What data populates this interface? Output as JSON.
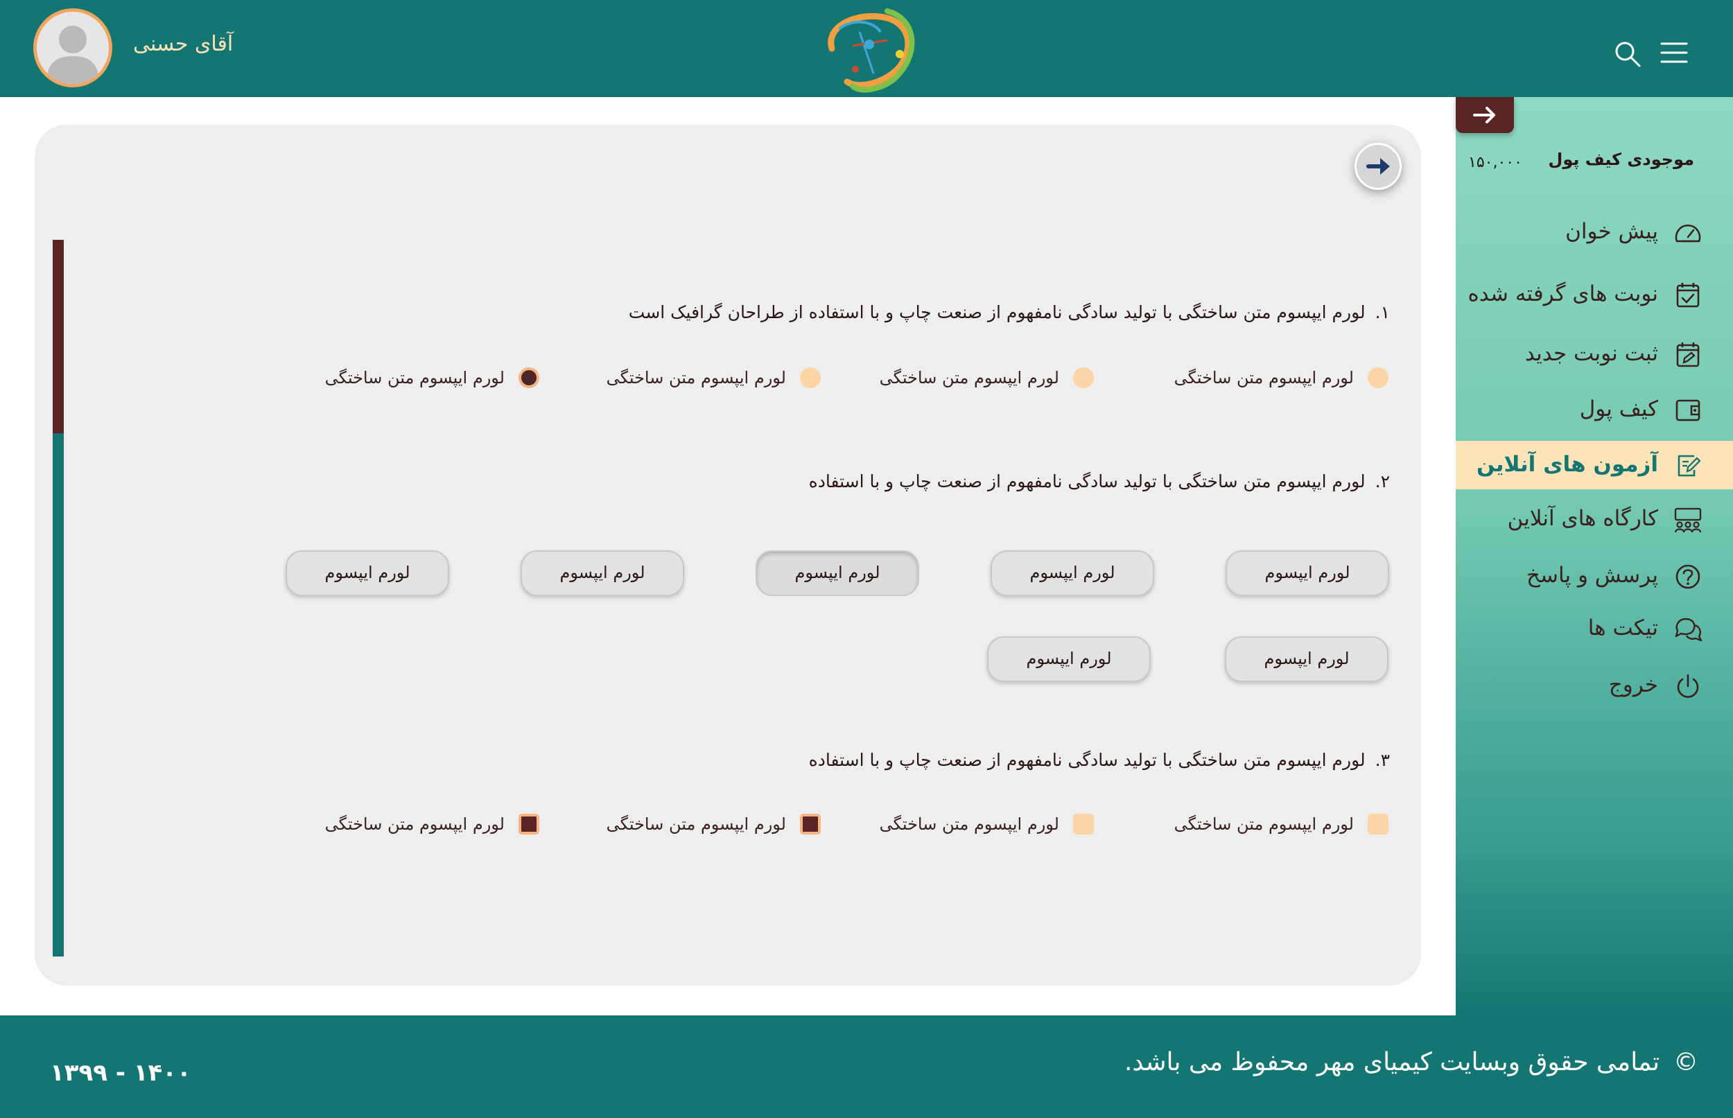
{
  "header": {
    "username": "آقای حسنی"
  },
  "sidebar": {
    "wallet_label": "موجودی کیف پول",
    "wallet_amount": "۱۵۰,۰۰۰",
    "items": [
      {
        "label": "پیش خوان",
        "icon": "speedometer-icon"
      },
      {
        "label": "نوبت های گرفته شده",
        "icon": "calendar-check-icon"
      },
      {
        "label": "ثبت نوبت جدید",
        "icon": "calendar-edit-icon"
      },
      {
        "label": "کیف پول",
        "icon": "wallet-icon"
      },
      {
        "label": "آزمون های آنلاین",
        "icon": "exam-edit-icon",
        "active": true
      },
      {
        "label": "کارگاه های آنلاین",
        "icon": "workshop-icon"
      },
      {
        "label": "پرسش و پاسخ",
        "icon": "question-circle-icon"
      },
      {
        "label": "تیکت ها",
        "icon": "chat-bubbles-icon"
      },
      {
        "label": "خروج",
        "icon": "power-icon"
      }
    ]
  },
  "exam": {
    "progress": 0.27,
    "questions": [
      {
        "number": "۱.",
        "text": "لورم ایپسوم متن ساختگی با تولید سادگی نامفهوم از صنعت چاپ و با استفاده از طراحان گرافیک است",
        "type": "radio",
        "options": [
          "لورم ایپسوم متن ساختگی",
          "لورم ایپسوم متن ساختگی",
          "لورم ایپسوم متن ساختگی",
          "لورم ایپسوم متن ساختگی"
        ],
        "selected": [
          3
        ]
      },
      {
        "number": "۲.",
        "text": "لورم ایپسوم متن ساختگی با تولید سادگی نامفهوم از صنعت چاپ و با استفاده",
        "type": "buttons",
        "options": [
          "لورم ایپسوم",
          "لورم ایپسوم",
          "لورم ایپسوم",
          "لورم ایپسوم",
          "لورم ایپسوم",
          "لورم ایپسوم",
          "لورم ایپسوم"
        ],
        "selected": [
          2
        ]
      },
      {
        "number": "۳.",
        "text": "لورم ایپسوم متن ساختگی با تولید سادگی نامفهوم از صنعت چاپ و با استفاده",
        "type": "checkbox",
        "options": [
          "لورم ایپسوم متن ساختگی",
          "لورم ایپسوم متن ساختگی",
          "لورم ایپسوم متن ساختگی",
          "لورم ایپسوم متن ساختگی"
        ],
        "selected": [
          2,
          3
        ]
      }
    ]
  },
  "footer": {
    "copyright": "تمامی حقوق وبسایت کیمیای مهر محفوظ می باشد.",
    "years": "۱۳۹۹ - ۱۴۰۰"
  },
  "colors": {
    "primary": "#147672",
    "accent_dark": "#5a2424",
    "accent_light": "#fcd5a6",
    "active_bg": "#fde3b8"
  }
}
